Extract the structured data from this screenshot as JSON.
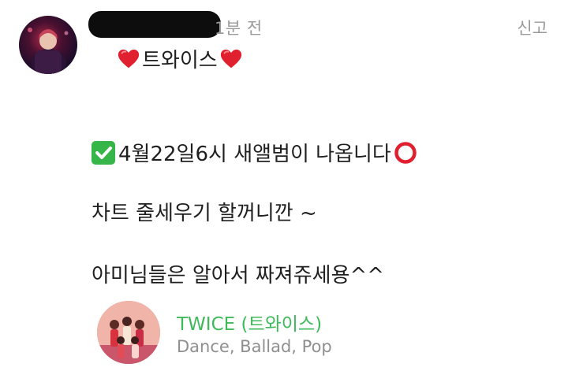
{
  "comment": {
    "time": "1분 전",
    "report_label": "신고",
    "line1": {
      "emoji_left": "red-heart",
      "text": "트와이스",
      "emoji_right": "red-heart"
    },
    "line2": {
      "emoji_left": "white-check-mark",
      "text": "4월22일6시 새앨범이 나옵니다",
      "emoji_right": "heavy-large-circle"
    },
    "line3": "차트 줄세우기 할꺼니깐 ~",
    "line4": "아미님들은 알아서 짜져쥬세용^^"
  },
  "music": {
    "title": "TWICE (트와이스)",
    "genre": "Dance, Ballad, Pop"
  },
  "colors": {
    "accent_green": "#3fb95a",
    "muted_text": "#9a9a9a",
    "heart_red": "#e0202e"
  }
}
